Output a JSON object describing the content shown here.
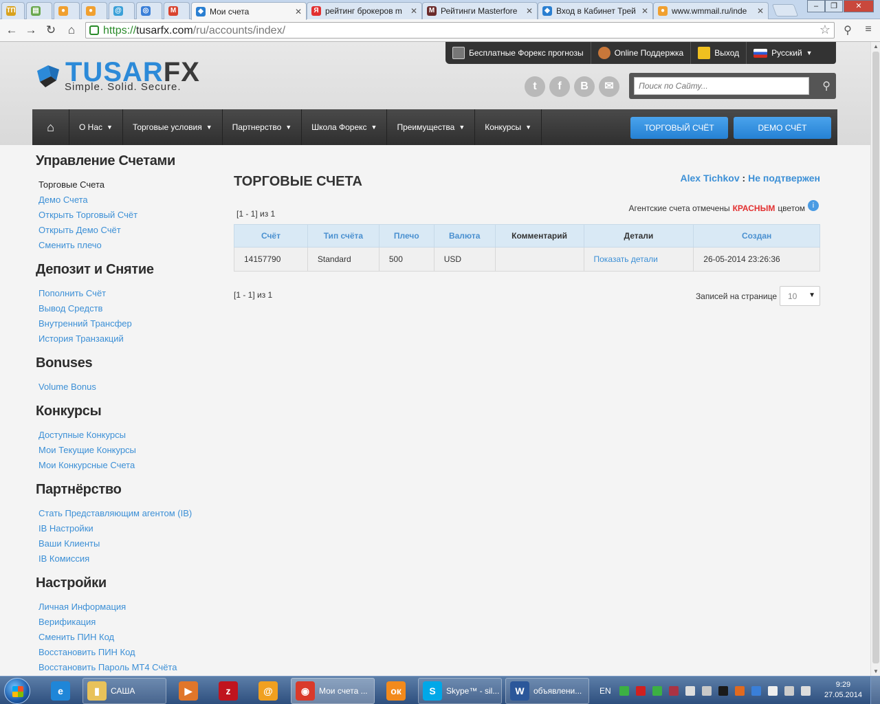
{
  "browser": {
    "tabs": [
      {
        "title": "",
        "color": "#d8a21e",
        "glyph": "ТП"
      },
      {
        "title": "",
        "color": "#6aa84f",
        "glyph": "▤"
      },
      {
        "title": "",
        "color": "#f0a030",
        "glyph": "●"
      },
      {
        "title": "",
        "color": "#f0a030",
        "glyph": "●"
      },
      {
        "title": "",
        "color": "#3aa0d8",
        "glyph": "@"
      },
      {
        "title": "",
        "color": "#3a7fd8",
        "glyph": "◎"
      },
      {
        "title": "",
        "color": "#d9442f",
        "glyph": "M"
      },
      {
        "title": "Мои счета",
        "color": "#2a7fd1",
        "glyph": "◆"
      },
      {
        "title": "рейтинг брокеров m",
        "color": "#e23030",
        "glyph": "Я"
      },
      {
        "title": "Рейтинги Masterfore",
        "color": "#6b2b2b",
        "glyph": "M"
      },
      {
        "title": "Вход в Кабинет Трей",
        "color": "#2a7fd1",
        "glyph": "◆"
      },
      {
        "title": "www.wmmail.ru/inde",
        "color": "#f0a030",
        "glyph": "●"
      }
    ],
    "url_scheme": "https://",
    "url_host": "tusarfx.com",
    "url_path": "/ru/accounts/index/"
  },
  "header": {
    "logo_main": "TUSAR",
    "logo_fx": "FX",
    "slogan": "Simple. Solid. Secure.",
    "topbar": {
      "forecast": "Бесплатные Форекс прогнозы",
      "support": "Online Поддержка",
      "logout": "Выход",
      "language": "Русский"
    },
    "search_placeholder": "Поиск по Сайту...",
    "nav": {
      "about": "О Нас",
      "conditions": "Торговые условия",
      "partnership": "Партнерство",
      "school": "Школа Форекс",
      "advantages": "Преимущества",
      "contests": "Конкурсы"
    },
    "cta_trading": "ТОРГОВЫЙ СЧЁТ",
    "cta_demo": "DEMO СЧЁТ"
  },
  "sidebar": [
    {
      "heading": "Управление Счетами",
      "items": [
        "Торговые Счета",
        "Демо Счета",
        "Открыть Торговый Счёт",
        "Открыть Демо Счёт",
        "Сменить плечо"
      ]
    },
    {
      "heading": "Депозит и Снятие",
      "items": [
        "Пополнить Счёт",
        "Вывод Средств",
        "Внутренний Трансфер",
        "История Транзакций"
      ]
    },
    {
      "heading": "Bonuses",
      "items": [
        "Volume Bonus"
      ]
    },
    {
      "heading": "Конкурсы",
      "items": [
        "Доступные Конкурсы",
        "Мои Текущие Конкурсы",
        "Мои Конкурсные Счета"
      ]
    },
    {
      "heading": "Партнёрство",
      "items": [
        "Стать Представляющим агентом (IB)",
        "IB Настройки",
        "Ваши Клиенты",
        "IB Комиссия"
      ]
    },
    {
      "heading": "Настройки",
      "items": [
        "Личная Информация",
        "Верификация",
        "Сменить ПИН Код",
        "Восстановить ПИН Код",
        "Восстановить Пароль MT4 Счёта"
      ]
    }
  ],
  "main": {
    "title": "ТОРГОВЫЕ СЧЕТА",
    "user_name": "Alex Tichkov",
    "user_sep": " : ",
    "user_status": "Не подтвержен",
    "pager_top": "[1 - 1] из 1",
    "agent_note_prefix": "Агентские счета отмечены",
    "agent_note_red": "КРАСНЫМ",
    "agent_note_suffix": "цветом",
    "table": {
      "headers": {
        "account": "Счёт",
        "type": "Тип счёта",
        "leverage": "Плечо",
        "currency": "Валюта",
        "comment": "Комментарий",
        "details": "Детали",
        "created": "Создан"
      },
      "rows": [
        {
          "account": "14157790",
          "type": "Standard",
          "leverage": "500",
          "currency": "USD",
          "comment": "",
          "details": "Показать детали",
          "created": "26-05-2014 23:26:36"
        }
      ]
    },
    "pager_bottom": "[1 - 1] из 1",
    "per_page_label": "Записей на странице",
    "per_page_value": "10"
  },
  "taskbar": {
    "items": [
      {
        "label": "",
        "color": "#1f86d8",
        "glyph": "e",
        "pin": true
      },
      {
        "label": "САША",
        "color": "#e8c25a",
        "glyph": "▮",
        "pin": false
      },
      {
        "label": "",
        "color": "#e0762a",
        "glyph": "▶",
        "pin": true
      },
      {
        "label": "",
        "color": "#c0141e",
        "glyph": "z",
        "pin": true
      },
      {
        "label": "",
        "color": "#f0a020",
        "glyph": "@",
        "pin": true
      },
      {
        "label": "Мои счета ...",
        "color": "#d93a2b",
        "glyph": "◉",
        "pin": false,
        "active": true
      },
      {
        "label": "",
        "color": "#f28a1c",
        "glyph": "ок",
        "pin": true
      },
      {
        "label": "Skype™ - sil...",
        "color": "#00a8e8",
        "glyph": "S",
        "pin": false
      },
      {
        "label": "объявлени...",
        "color": "#2b579a",
        "glyph": "W",
        "pin": false
      }
    ],
    "language": "EN",
    "time": "9:29",
    "date": "27.05.2014"
  }
}
